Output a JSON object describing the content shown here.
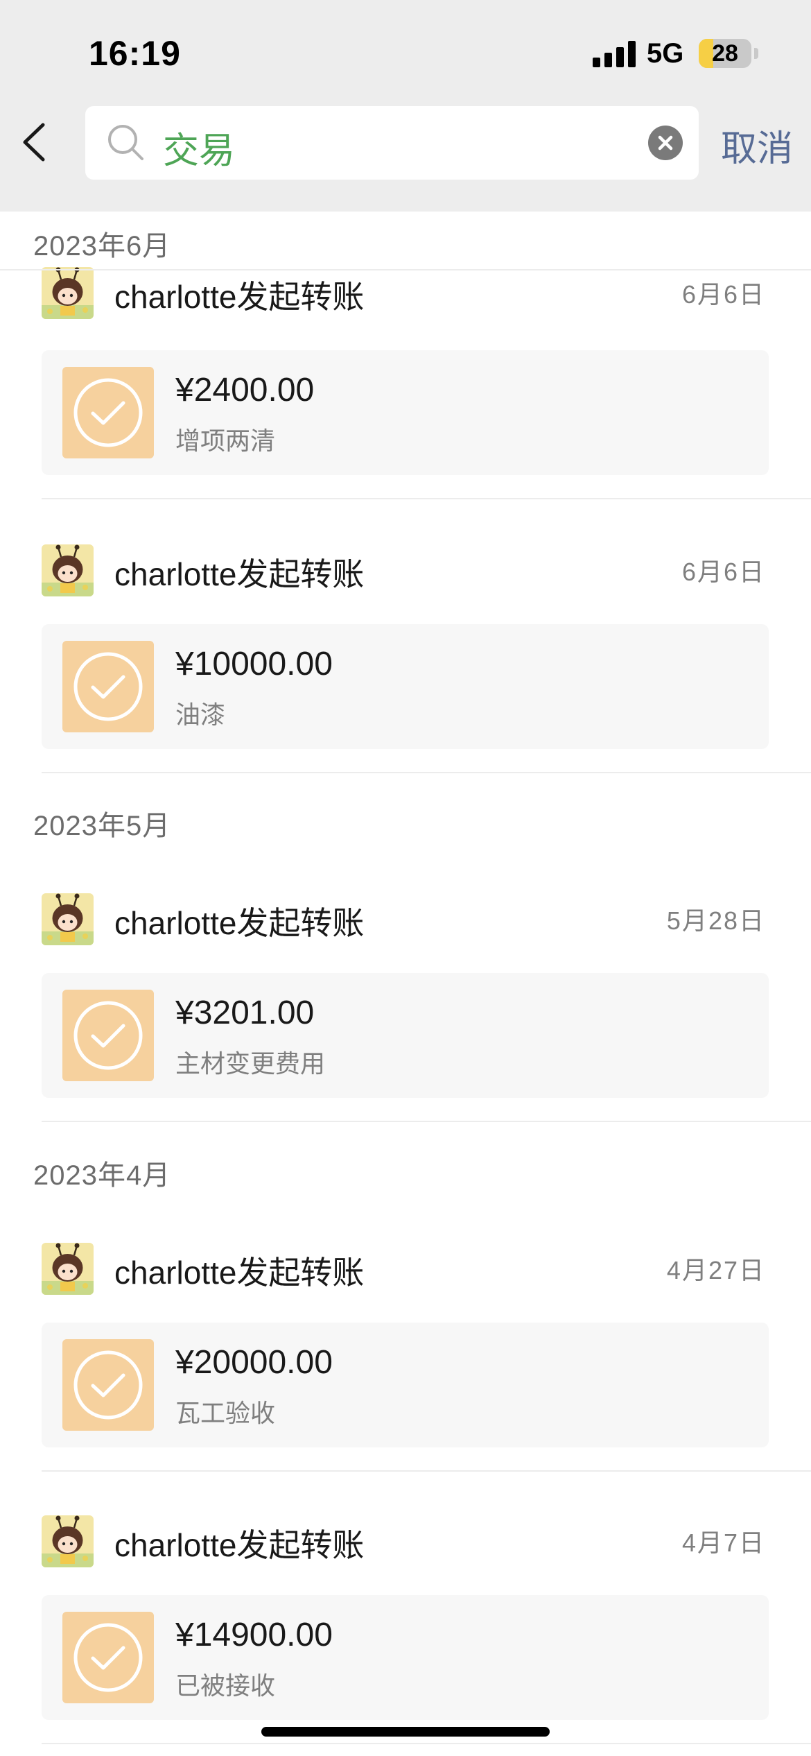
{
  "status_bar": {
    "time": "16:19",
    "network": "5G",
    "battery": "28",
    "battery_level": 0.28
  },
  "search": {
    "value": "交易",
    "cancel_label": "取消"
  },
  "sticky_header": "2023年6月",
  "groups": [
    {
      "month": "2023年6月",
      "entries": [
        {
          "title": "charlotte发起转账",
          "date": "6月6日",
          "amount": "¥2400.00",
          "note": "增项两清"
        },
        {
          "title": "charlotte发起转账",
          "date": "6月6日",
          "amount": "¥10000.00",
          "note": "油漆"
        }
      ]
    },
    {
      "month": "2023年5月",
      "entries": [
        {
          "title": "charlotte发起转账",
          "date": "5月28日",
          "amount": "¥3201.00",
          "note": "主材变更费用"
        }
      ]
    },
    {
      "month": "2023年4月",
      "entries": [
        {
          "title": "charlotte发起转账",
          "date": "4月27日",
          "amount": "¥20000.00",
          "note": "瓦工验收"
        },
        {
          "title": "charlotte发起转账",
          "date": "4月7日",
          "amount": "¥14900.00",
          "note": "已被接收"
        }
      ]
    }
  ],
  "colors": {
    "accent_green": "#4ea556",
    "link_blue": "#576b95",
    "card_icon_bg": "#f6d19e"
  },
  "icons": {
    "back": "chevron-left-icon",
    "search": "search-icon",
    "clear": "clear-icon",
    "status": "check-circle-icon"
  }
}
